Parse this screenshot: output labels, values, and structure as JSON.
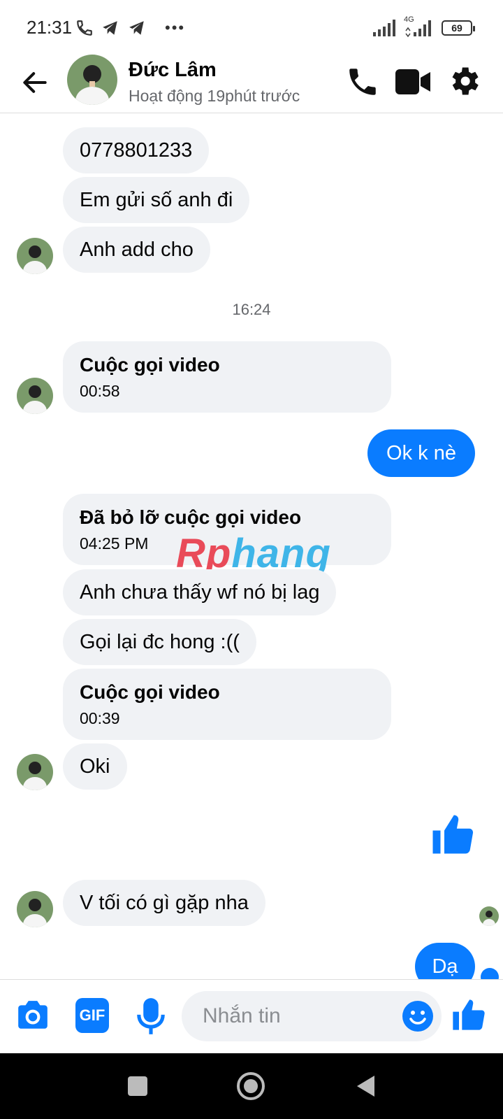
{
  "status_bar": {
    "time": "21:31",
    "network": "4G",
    "battery": "69"
  },
  "header": {
    "name": "Đức Lâm",
    "status": "Hoạt động 19phút trước"
  },
  "messages": {
    "m1": "0778801233",
    "m2": "Em gửi số anh đi",
    "m3": "Anh add cho",
    "timestamp": "16:24",
    "call1_title": "Cuộc gọi video",
    "call1_duration": "00:58",
    "mine1": "Ok k nè",
    "missed_title": "Đã bỏ lỡ cuộc gọi video",
    "missed_time": "04:25 PM",
    "m4": "Anh chưa thấy wf nó bị lag",
    "m5": "Gọi lại đc hong :((",
    "call2_title": "Cuộc gọi video",
    "call2_duration": "00:39",
    "m6": "Oki",
    "m7": "V tối có gì gặp nha",
    "mine2": "Dạ"
  },
  "watermark": {
    "part1": "Rp",
    "part2": "hang"
  },
  "composer": {
    "gif_label": "GIF",
    "placeholder": "Nhắn tin"
  },
  "colors": {
    "accent": "#0a7cff",
    "bubble_gray": "#f0f2f5",
    "secondary_text": "#65676b"
  },
  "icons": [
    "back-arrow-icon",
    "phone-icon",
    "video-camera-icon",
    "gear-icon",
    "camera-icon",
    "gif-icon",
    "microphone-icon",
    "emoji-icon",
    "thumbs-up-icon"
  ]
}
